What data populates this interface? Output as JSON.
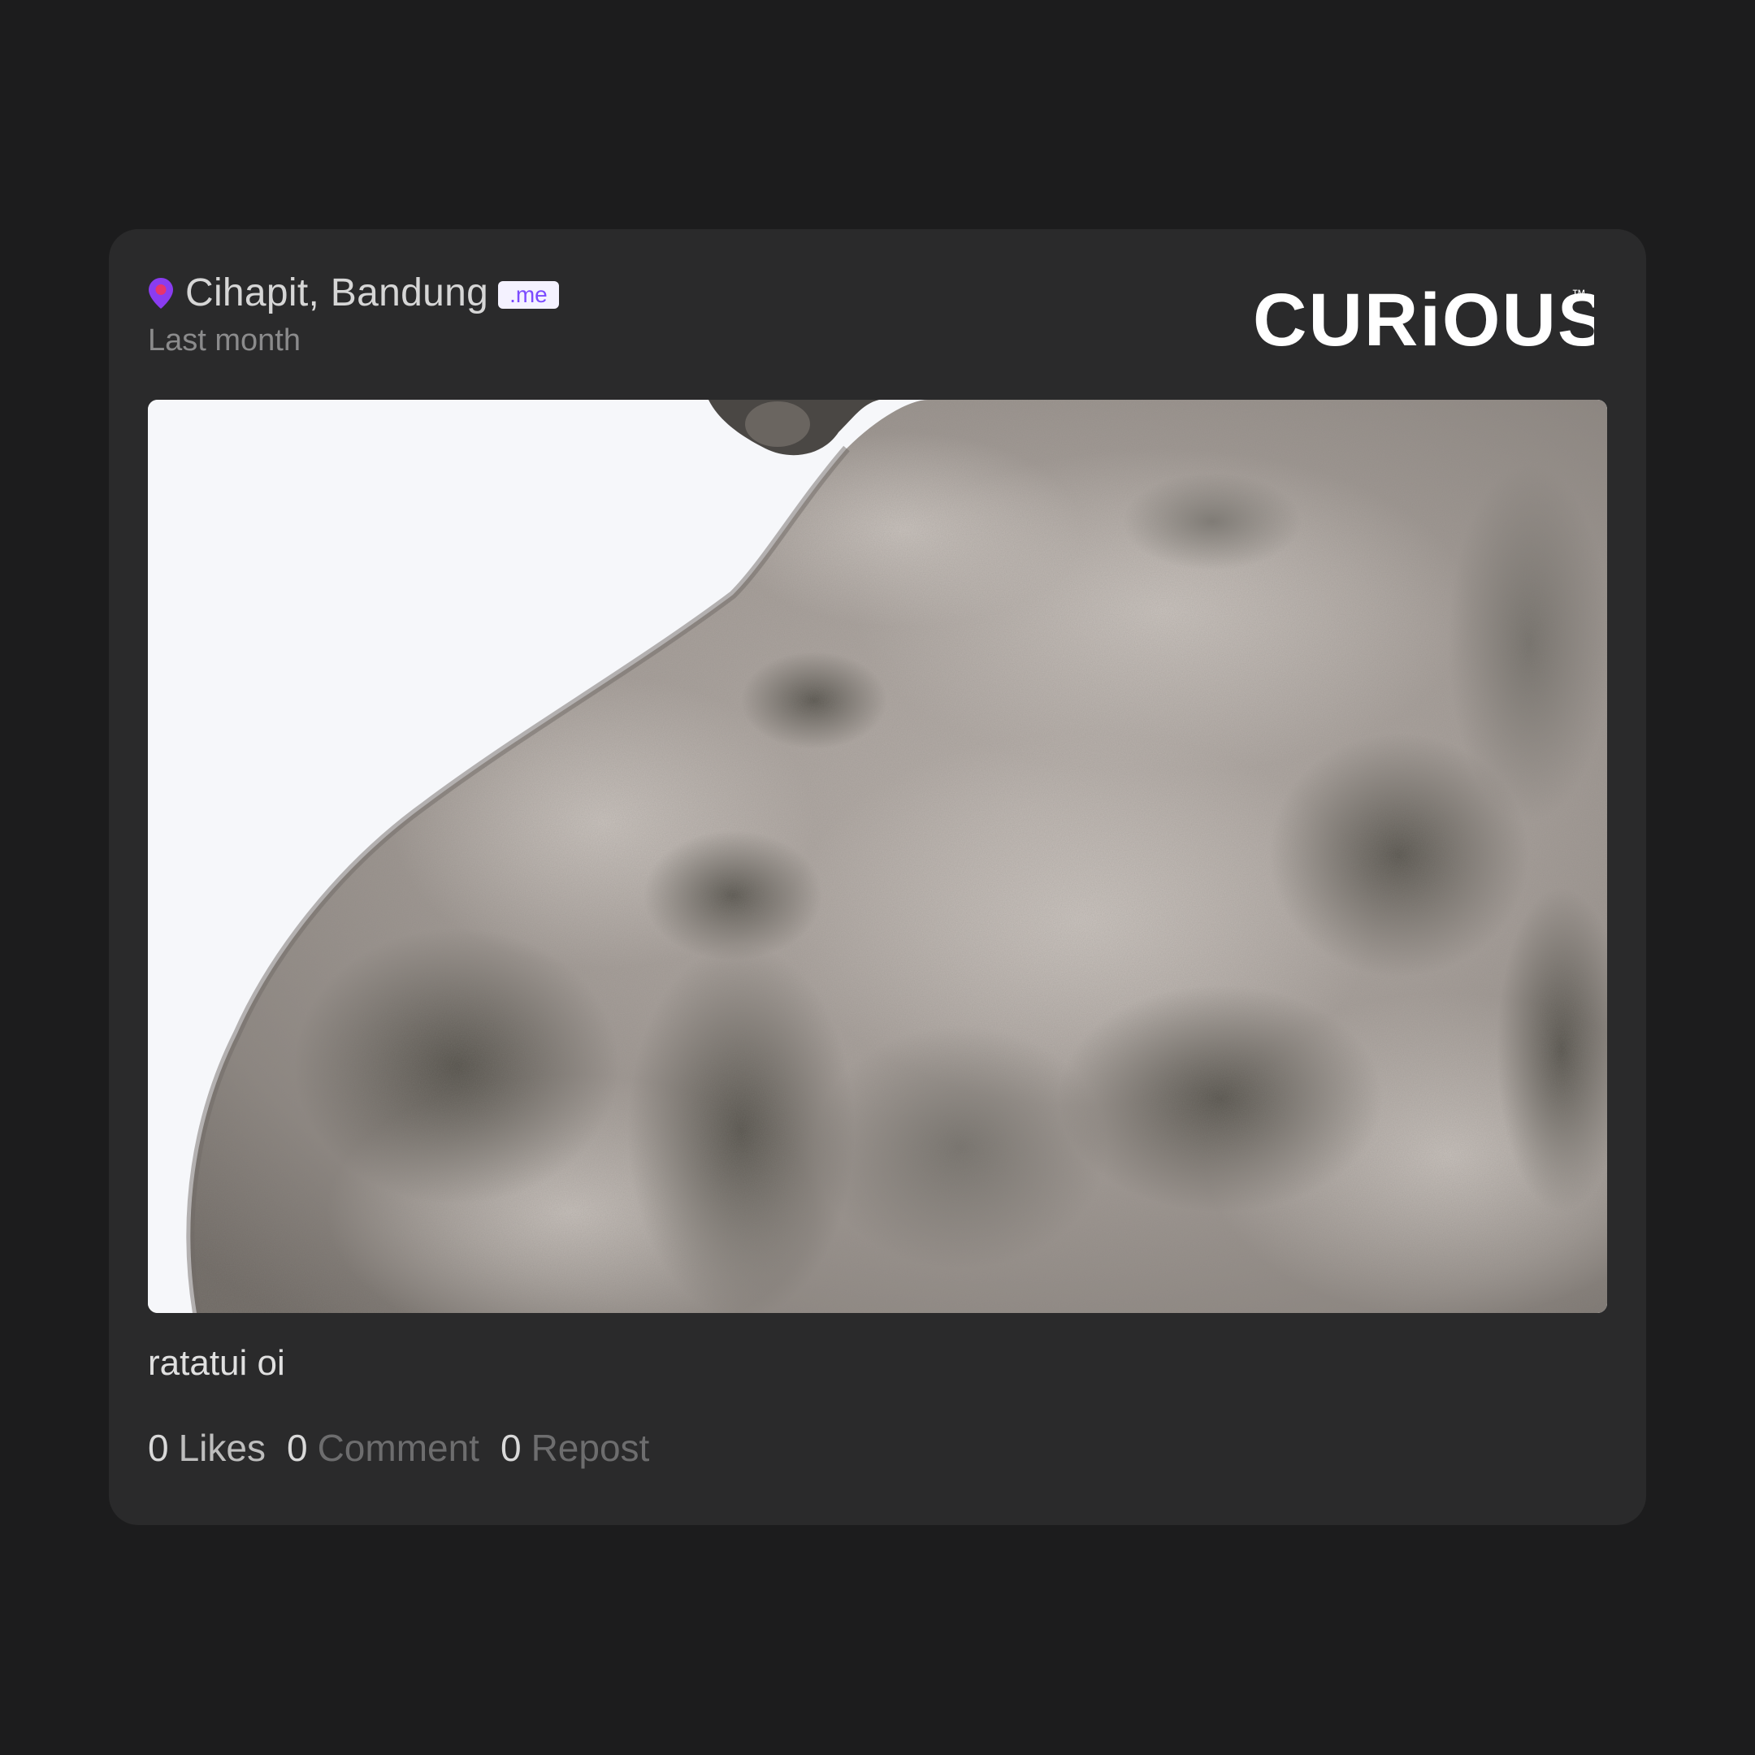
{
  "post": {
    "location": "Cihapit, Bandung",
    "badge": ".me",
    "time": "Last month",
    "caption": "ratatui oi",
    "photo_alt": "Close-up of weathered stone statue back against white sky",
    "stats": {
      "likes_count": "0",
      "likes_label": "Likes",
      "comment_count": "0",
      "comment_label": "Comment",
      "repost_count": "0",
      "repost_label": "Repost"
    }
  },
  "brand": {
    "name": "CURiOUS",
    "trademark": "™"
  },
  "colors": {
    "background": "#1c1c1d",
    "card": "#2a2a2b",
    "accent": "#7b4bff",
    "pin": "#8a3cf0"
  },
  "icons": {
    "location": "map-pin-icon"
  }
}
